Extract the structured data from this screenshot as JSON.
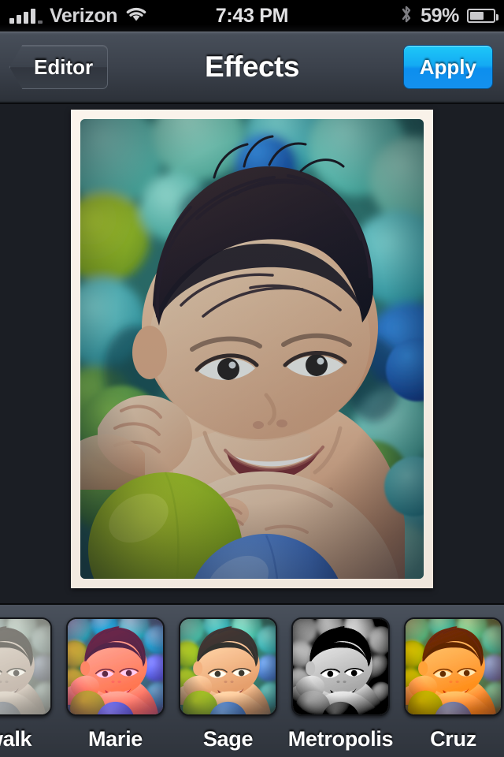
{
  "status_bar": {
    "carrier": "Verizon",
    "signal_icon": "signal-bars-icon",
    "wifi_icon": "wifi-icon",
    "time": "7:43 PM",
    "bluetooth_icon": "bluetooth-icon",
    "battery_percent": "59%",
    "battery_level": 55,
    "battery_icon": "battery-icon"
  },
  "nav_bar": {
    "back_label": "Editor",
    "back_icon": "chevron-left-icon",
    "title": "Effects",
    "apply_label": "Apply",
    "accent_color": "#12a3f1",
    "bar_color": "#3b414b"
  },
  "photo": {
    "subject": "baby in ball pit",
    "frame_color": "#f7efe6",
    "applied_filter": "Sage"
  },
  "filters": {
    "items": [
      {
        "label": "dwalk",
        "full_label": "Boardwalk",
        "selected": false,
        "partial": true
      },
      {
        "label": "Marie",
        "selected": false,
        "partial": false
      },
      {
        "label": "Sage",
        "selected": false,
        "partial": false
      },
      {
        "label": "Metropolis",
        "selected": false,
        "partial": false
      },
      {
        "label": "Cruz",
        "selected": false,
        "partial": false
      }
    ]
  }
}
